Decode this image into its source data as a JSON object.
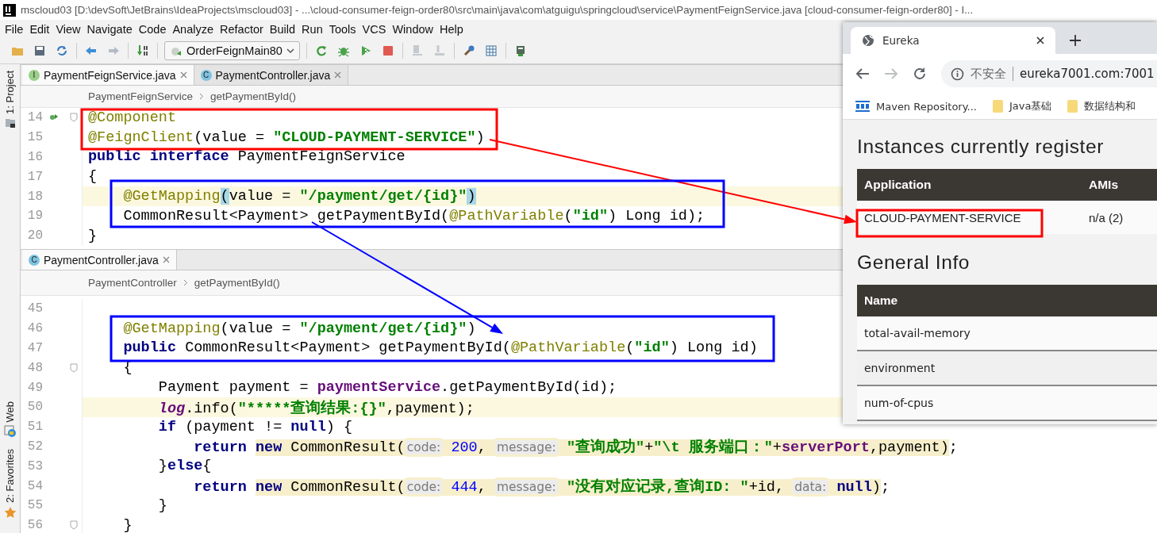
{
  "ide": {
    "title": "mscloud03 [D:\\devSoft\\JetBrains\\IdeaProjects\\mscloud03] - ...\\cloud-consumer-feign-order80\\src\\main\\java\\com\\atguigu\\springcloud\\service\\PaymentFeignService.java [cloud-consumer-feign-order80] - I...",
    "menu": [
      "File",
      "Edit",
      "View",
      "Navigate",
      "Code",
      "Analyze",
      "Refactor",
      "Build",
      "Run",
      "Tools",
      "VCS",
      "Window",
      "Help"
    ],
    "run_config": "OrderFeignMain80",
    "tool_windows": [
      {
        "label": "1: Project"
      },
      {
        "label": "Web"
      },
      {
        "label": "2: Favorites"
      }
    ],
    "editors": [
      {
        "tabs": [
          {
            "label": "PaymentFeignService.java",
            "icon_letter": "I",
            "color": "#9bd08a",
            "selected": true
          },
          {
            "label": "PaymentController.java",
            "icon_letter": "C",
            "color": "#7ec3e0",
            "selected": false
          }
        ],
        "breadcrumb": [
          "PaymentFeignService",
          "getPaymentById()"
        ],
        "lines": [
          {
            "number": "14",
            "highlighted": false,
            "implemented": true,
            "foldable": true,
            "tokens": [
              {
                "kind": "annotation",
                "text": "@Component"
              }
            ]
          },
          {
            "number": "15",
            "highlighted": false,
            "tokens": [
              {
                "kind": "annotation",
                "text": "@FeignClient"
              },
              {
                "kind": "plain",
                "text": "(value = "
              },
              {
                "kind": "string",
                "text": "\"CLOUD-PAYMENT-SERVICE\""
              },
              {
                "kind": "plain",
                "text": ")"
              }
            ]
          },
          {
            "number": "16",
            "highlighted": false,
            "tokens": [
              {
                "kind": "keyword",
                "text": "public "
              },
              {
                "kind": "keyword",
                "text": "interface"
              },
              {
                "kind": "plain",
                "text": " PaymentFeignService"
              }
            ]
          },
          {
            "number": "17",
            "highlighted": false,
            "tokens": [
              {
                "kind": "plain",
                "text": "{"
              }
            ]
          },
          {
            "number": "18",
            "highlighted": true,
            "tokens": [
              {
                "kind": "annotation",
                "text": "    @GetMapping"
              },
              {
                "kind": "brace",
                "text": "("
              },
              {
                "kind": "plain",
                "text": "value = "
              },
              {
                "kind": "string",
                "text": "\"/payment/get/{id}\""
              },
              {
                "kind": "brace",
                "text": ")"
              }
            ]
          },
          {
            "number": "19",
            "highlighted": false,
            "tokens": [
              {
                "kind": "plain",
                "text": "    CommonResult<Payment> getPaymentById("
              },
              {
                "kind": "annotation",
                "text": "@PathVariable"
              },
              {
                "kind": "plain",
                "text": "("
              },
              {
                "kind": "string",
                "text": "\"id\""
              },
              {
                "kind": "plain",
                "text": ") Long id);"
              }
            ]
          },
          {
            "number": "20",
            "highlighted": false,
            "tokens": [
              {
                "kind": "plain",
                "text": "}"
              }
            ]
          }
        ]
      },
      {
        "tabs": [
          {
            "label": "PaymentController.java",
            "icon_letter": "C",
            "color": "#7ec3e0",
            "selected": true
          }
        ],
        "breadcrumb": [
          "PaymentController",
          "getPaymentById()"
        ],
        "lines": [
          {
            "number": "45",
            "highlighted": false
          },
          {
            "number": "46",
            "highlighted": false,
            "tokens": [
              {
                "kind": "annotation",
                "text": "    @GetMapping"
              },
              {
                "kind": "plain",
                "text": "(value = "
              },
              {
                "kind": "string",
                "text": "\"/payment/get/{id}\""
              },
              {
                "kind": "plain",
                "text": ")"
              }
            ]
          },
          {
            "number": "47",
            "highlighted": false,
            "tokens": [
              {
                "kind": "keyword",
                "text": "    public"
              },
              {
                "kind": "plain",
                "text": " CommonResult<Payment> getPaymentById("
              },
              {
                "kind": "annotation",
                "text": "@PathVariable"
              },
              {
                "kind": "plain",
                "text": "("
              },
              {
                "kind": "string",
                "text": "\"id\""
              },
              {
                "kind": "plain",
                "text": ") Long id)"
              }
            ]
          },
          {
            "number": "48",
            "highlighted": false,
            "foldable": true,
            "tokens": [
              {
                "kind": "plain",
                "text": "    {"
              }
            ]
          },
          {
            "number": "49",
            "highlighted": false,
            "tokens": [
              {
                "kind": "plain",
                "text": "        Payment payment = "
              },
              {
                "kind": "field",
                "text": "paymentService"
              },
              {
                "kind": "plain",
                "text": ".getPaymentById(id);"
              }
            ]
          },
          {
            "number": "50",
            "highlighted": true,
            "tokens": [
              {
                "kind": "static",
                "text": "        log"
              },
              {
                "kind": "plain",
                "text": ".info("
              },
              {
                "kind": "string",
                "text": "\"*****查询结果:{}\""
              },
              {
                "kind": "plain",
                "text": ",payment);"
              }
            ]
          },
          {
            "number": "51",
            "highlighted": false,
            "tokens": [
              {
                "kind": "keyword",
                "text": "        if"
              },
              {
                "kind": "plain",
                "text": " (payment != "
              },
              {
                "kind": "keyword",
                "text": "null"
              },
              {
                "kind": "plain",
                "text": ") {"
              }
            ]
          },
          {
            "number": "52",
            "highlighted": false,
            "tokens": [
              {
                "kind": "keyword",
                "text": "            return ",
                "marked": false
              },
              {
                "kind": "keyword",
                "text": "new",
                "marked": true
              },
              {
                "kind": "plain",
                "text": " CommonResult(",
                "marked": true
              },
              {
                "kind": "hint",
                "text": "code:",
                "marked": true
              },
              {
                "kind": "number",
                "text": " 200",
                "marked": true
              },
              {
                "kind": "plain",
                "text": ", ",
                "marked": true
              },
              {
                "kind": "hint",
                "text": "message:",
                "marked": true
              },
              {
                "kind": "string",
                "text": " \"查询成功\"",
                "marked": true
              },
              {
                "kind": "plain",
                "text": "+",
                "marked": true
              },
              {
                "kind": "string",
                "text": "\"\\t 服务端口：\"",
                "marked": true
              },
              {
                "kind": "plain",
                "text": "+",
                "marked": true
              },
              {
                "kind": "field",
                "text": "serverPort",
                "marked": true
              },
              {
                "kind": "plain",
                "text": ",payment)",
                "marked": true
              },
              {
                "kind": "plain",
                "text": ";",
                "marked": false
              }
            ]
          },
          {
            "number": "53",
            "highlighted": false,
            "tokens": [
              {
                "kind": "plain",
                "text": "        }"
              },
              {
                "kind": "keyword",
                "text": "else"
              },
              {
                "kind": "plain",
                "text": "{"
              }
            ]
          },
          {
            "number": "54",
            "highlighted": false,
            "tokens": [
              {
                "kind": "keyword",
                "text": "            return ",
                "marked": false
              },
              {
                "kind": "keyword",
                "text": "new",
                "marked": true
              },
              {
                "kind": "plain",
                "text": " CommonResult(",
                "marked": true
              },
              {
                "kind": "hint",
                "text": "code:",
                "marked": true
              },
              {
                "kind": "number",
                "text": " 444",
                "marked": true
              },
              {
                "kind": "plain",
                "text": ", ",
                "marked": true
              },
              {
                "kind": "hint",
                "text": "message:",
                "marked": true
              },
              {
                "kind": "string",
                "text": " \"没有对应记录,查询ID: \"",
                "marked": true
              },
              {
                "kind": "plain",
                "text": "+id, ",
                "marked": true
              },
              {
                "kind": "hint",
                "text": "data:",
                "marked": true
              },
              {
                "kind": "keyword",
                "text": " null",
                "marked": true
              },
              {
                "kind": "plain",
                "text": ")",
                "marked": true
              },
              {
                "kind": "plain",
                "text": ";",
                "marked": false
              }
            ]
          },
          {
            "number": "55",
            "highlighted": false,
            "tokens": [
              {
                "kind": "plain",
                "text": "        }"
              }
            ]
          },
          {
            "number": "56",
            "highlighted": false,
            "foldable": true,
            "tokens": [
              {
                "kind": "plain",
                "text": "    }"
              }
            ]
          }
        ]
      }
    ]
  },
  "browser": {
    "tabs": [
      {
        "title": "Eureka",
        "selected": true
      }
    ],
    "back_disabled": false,
    "forward_disabled": true,
    "security_label": "不安全",
    "url": "eureka7001.com:7001",
    "bookmarks": [
      {
        "label": "Maven Repository..."
      },
      {
        "label": "Java基础"
      },
      {
        "label": "数据结构和"
      }
    ],
    "page": {
      "instances_heading": "Instances currently register",
      "instances_table": {
        "columns": [
          "Application",
          "AMIs"
        ],
        "rows": [
          [
            "CLOUD-PAYMENT-SERVICE",
            "n/a (2)"
          ]
        ]
      },
      "general_heading": "General Info",
      "general_table": {
        "columns": [
          "Name"
        ],
        "rows": [
          [
            "total-avail-memory"
          ],
          [
            "environment"
          ],
          [
            "num-of-cpus"
          ]
        ]
      }
    }
  },
  "annotations": [
    {
      "kind": "box",
      "color": "#ff0000"
    },
    {
      "kind": "box",
      "color": "#ff0000"
    },
    {
      "kind": "arrow",
      "color": "#ff0000"
    },
    {
      "kind": "box",
      "color": "#0000ff"
    },
    {
      "kind": "box",
      "color": "#0000ff"
    },
    {
      "kind": "arrow",
      "color": "#0000ff"
    }
  ]
}
